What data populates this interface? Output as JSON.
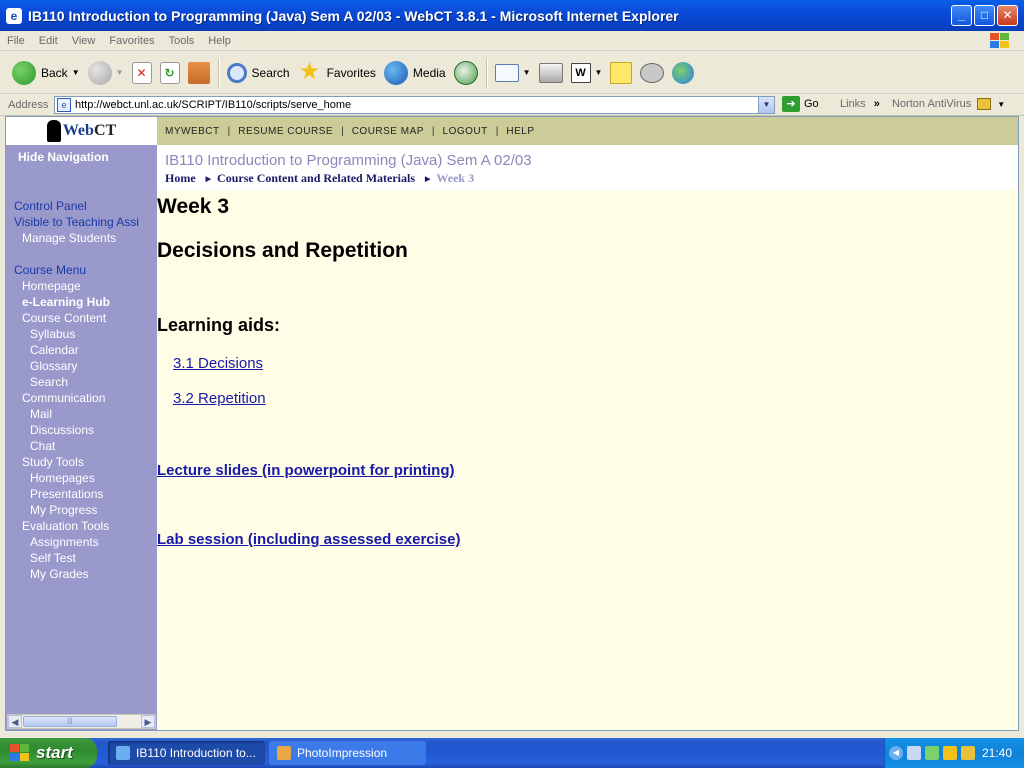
{
  "window": {
    "title": "IB110 Introduction to Programming (Java) Sem A 02/03 - WebCT 3.8.1 - Microsoft Internet Explorer",
    "icon": "ie-page-icon"
  },
  "menubar": {
    "items": [
      "File",
      "Edit",
      "View",
      "Favorites",
      "Tools",
      "Help"
    ]
  },
  "toolbar": {
    "back": "Back",
    "search": "Search",
    "favorites": "Favorites",
    "media": "Media"
  },
  "address": {
    "label": "Address",
    "url": "http://webct.unl.ac.uk/SCRIPT/IB110/scripts/serve_home",
    "go": "Go",
    "links": "Links",
    "norton": "Norton AntiVirus"
  },
  "nav": {
    "logo_prefix": "Web",
    "logo_suffix": "CT",
    "hide": "Hide Navigation",
    "control_panel": "Control Panel",
    "visible_to": "Visible to Teaching Assi",
    "manage_students": "Manage Students",
    "course_menu": "Course Menu",
    "homepage": "Homepage",
    "hub": "e-Learning Hub",
    "course_content": "Course Content",
    "syllabus": "Syllabus",
    "calendar": "Calendar",
    "glossary": "Glossary",
    "search": "Search",
    "communication": "Communication",
    "mail": "Mail",
    "discussions": "Discussions",
    "chat": "Chat",
    "study_tools": "Study Tools",
    "homepages": "Homepages",
    "presentations": "Presentations",
    "my_progress": "My Progress",
    "evaluation_tools": "Evaluation Tools",
    "assignments": "Assignments",
    "self_test": "Self Test",
    "my_grades": "My Grades"
  },
  "topnav": {
    "mywebct": "MYWEBCT",
    "resume": "RESUME COURSE",
    "map": "COURSE MAP",
    "logout": "LOGOUT",
    "help": "HELP"
  },
  "header": {
    "course_title": "IB110 Introduction to Programming (Java) Sem A 02/03",
    "crumb_home": "Home",
    "crumb_content": "Course Content and Related Materials",
    "crumb_current": "Week 3"
  },
  "content": {
    "week": "Week 3",
    "topic": "Decisions and Repetition",
    "aids": "Learning aids:",
    "link1": "3.1 Decisions",
    "link2": "3.2 Repetition",
    "lecture": "Lecture slides (in powerpoint for printing)",
    "lab": "Lab session (including assessed exercise)"
  },
  "taskbar": {
    "start": "start",
    "task1": "IB110 Introduction to...",
    "task2": "PhotoImpression",
    "clock": "21:40"
  },
  "colors": {
    "nav_bg": "#9999cc",
    "topnav_bg": "#cccc99",
    "content_bg": "#fffde6",
    "link": "#1a1aa8"
  }
}
